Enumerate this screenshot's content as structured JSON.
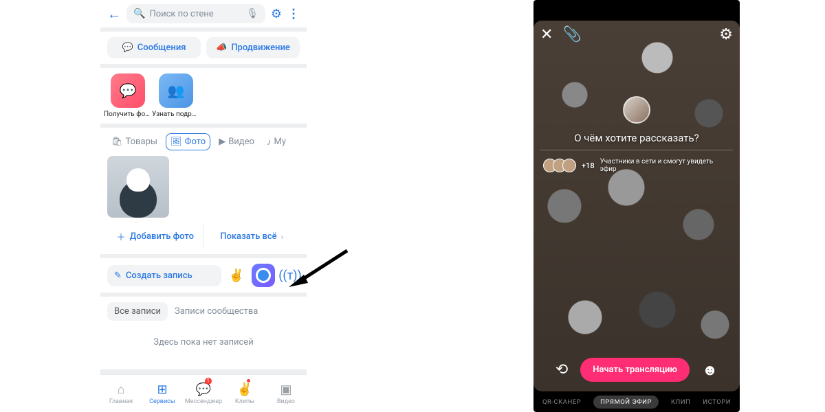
{
  "left": {
    "search_placeholder": "Поиск по стене",
    "actions": {
      "messages": "Сообщения",
      "promo": "Продвижение"
    },
    "tiles": [
      {
        "label": "Получить фот…"
      },
      {
        "label": "Узнать подро…"
      }
    ],
    "tabs": {
      "goods": "Товары",
      "photo": "Фото",
      "video": "Видео",
      "music": "Му"
    },
    "add_photo": "Добавить фото",
    "show_all": "Показать всё",
    "compose": "Создать запись",
    "filters": {
      "all": "Все записи",
      "community": "Записи сообщества"
    },
    "empty": "Здесь пока нет записей",
    "nav": {
      "home": "Главная",
      "services": "Сервисы",
      "messenger": "Мессенджер",
      "clips": "Клипы",
      "video": "Видео",
      "messenger_badge": "1"
    }
  },
  "right": {
    "prompt": "О чём хотите рассказать?",
    "viewers_count": "+18",
    "viewers_text": "Участники в сети и смогут увидеть эфир",
    "start": "Начать трансляцию",
    "modes": {
      "qr": "QR-СКАНЕР",
      "live": "ПРЯМОЙ ЭФИР",
      "clip": "КЛИП",
      "story": "ИСТОРИ"
    }
  }
}
